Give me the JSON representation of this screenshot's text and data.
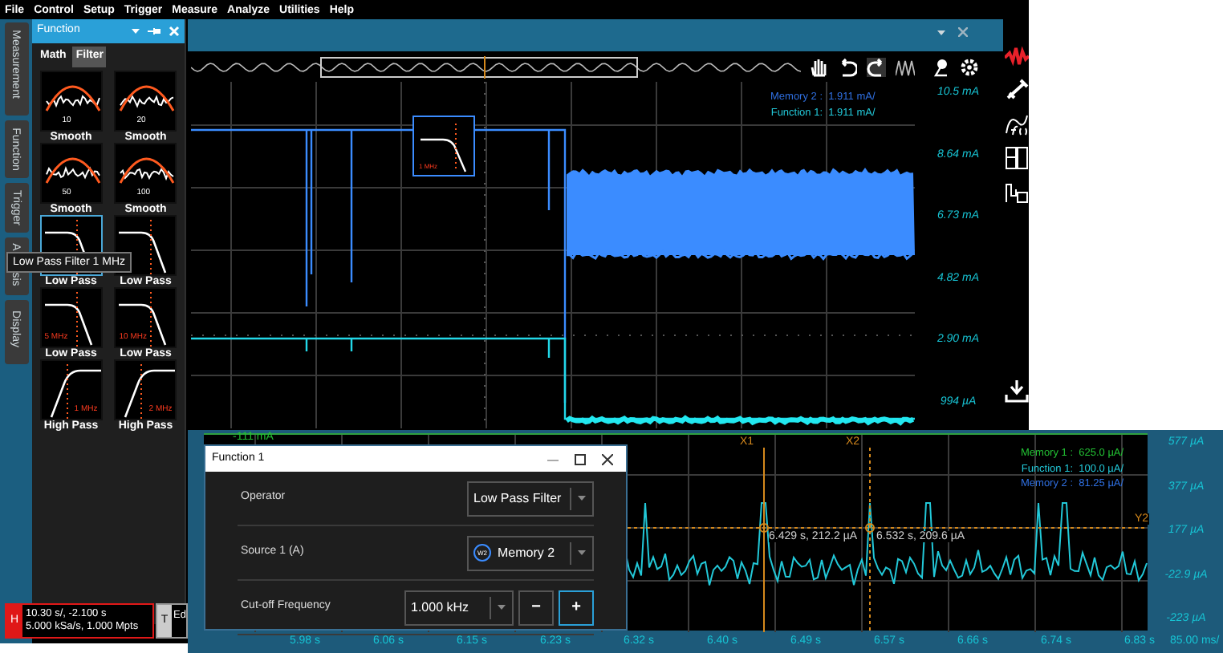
{
  "menu": [
    "File",
    "Control",
    "Setup",
    "Trigger",
    "Measure",
    "Analyze",
    "Utilities",
    "Help"
  ],
  "side_tabs": [
    {
      "labels": [
        "Measurement"
      ]
    },
    {
      "labels": [
        "Function"
      ]
    },
    {
      "labels": [
        "Trigger"
      ]
    },
    {
      "labels": [
        "A",
        "sis"
      ]
    },
    {
      "labels": [
        "Display"
      ]
    }
  ],
  "function_panel": {
    "title": "Function",
    "tabs": [
      {
        "label": "Math",
        "selected": false
      },
      {
        "label": "Filter",
        "selected": true
      }
    ],
    "filters": [
      {
        "kind": "smooth",
        "value": "10",
        "label": "Smooth",
        "selected": false
      },
      {
        "kind": "smooth",
        "value": "20",
        "label": "Smooth",
        "selected": false
      },
      {
        "kind": "smooth",
        "value": "50",
        "label": "Smooth",
        "selected": false
      },
      {
        "kind": "smooth",
        "value": "100",
        "label": "Smooth",
        "selected": false
      },
      {
        "kind": "lowpass",
        "label": "Low Pass",
        "selected": true
      },
      {
        "kind": "lowpass",
        "label": "Low Pass",
        "selected": false
      },
      {
        "kind": "lowpass",
        "value": "5 MHz",
        "label": "Low Pass",
        "selected": false
      },
      {
        "kind": "lowpass",
        "value": "10 MHz",
        "label": "Low Pass",
        "selected": false
      },
      {
        "kind": "highpass",
        "value": "1 MHz",
        "label": "High Pass",
        "selected": false
      },
      {
        "kind": "highpass",
        "value": "2 MHz",
        "label": "High Pass",
        "selected": false
      }
    ]
  },
  "tooltip": "Low Pass Filter 1 MHz",
  "scope": {
    "filter_overlay_label": "1 MHz",
    "legend": [
      {
        "text": "Memory 2 :  1.911 mA/",
        "color": "#2f6fe0"
      },
      {
        "text": "Function 1:  1.911 mA/",
        "color": "#22c8d8"
      }
    ],
    "y_labels": [
      "10.5 mA",
      "8.64 mA",
      "6.73 mA",
      "4.82 mA",
      "2.90 mA",
      "994 µA"
    ]
  },
  "status": {
    "horizontal": {
      "badge": "H",
      "lines": [
        "10.30 s/, -2.100 s",
        "5.000 kSa/s, 1.000 Mpts"
      ]
    },
    "trigger": {
      "badge": "T",
      "text": "Ed"
    }
  },
  "zoom": {
    "offset_label": "-111 mA",
    "legend": [
      {
        "text": "Memory 1 :  625.0 µA/",
        "color": "#22c033"
      },
      {
        "text": "Function 1:  100.0 µA/",
        "color": "#22c8d8"
      },
      {
        "text": "Memory 2 :  81.25 µA/",
        "color": "#2f6fe0"
      }
    ],
    "cursors": [
      "X1",
      "X2",
      "Y2"
    ],
    "readouts": [
      "6.429 s, 212.2 µA",
      "6.532 s, 209.6 µA"
    ],
    "y_labels": [
      "577 µA",
      "377 µA",
      "177 µA",
      "-22.9 µA",
      "-223 µA"
    ],
    "x_labels": [
      "5.98 s",
      "6.06 s",
      "6.15 s",
      "6.23 s",
      "6.32 s",
      "6.40 s",
      "6.49 s",
      "6.57 s",
      "6.66 s",
      "6.74 s",
      "6.83 s"
    ],
    "timebase": "85.00 ms/"
  },
  "dialog": {
    "title": "Function 1",
    "rows": [
      {
        "kind": "select",
        "label": "Operator",
        "value": "Low Pass Filter"
      },
      {
        "kind": "source",
        "label": "Source 1 (A)",
        "badge": "W2",
        "value": "Memory 2"
      },
      {
        "kind": "stepper",
        "label": "Cut-off Frequency",
        "value": "1.000 kHz",
        "minus": "−",
        "plus": "+"
      }
    ]
  }
}
